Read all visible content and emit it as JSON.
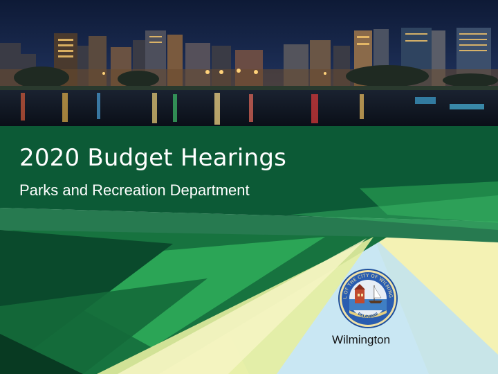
{
  "slide": {
    "title": "2020 Budget Hearings",
    "subtitle": "Parks and Recreation Department",
    "seal_label": "Wilmington",
    "seal_ring_text": "SEAL OF THE CITY OF WILMINGTON",
    "seal_bottom_text": "DELAWARE"
  },
  "colors": {
    "dark_green": "#0c5a36",
    "mid_green": "#1f8a4a",
    "bright_green": "#2fae5a",
    "light_green": "#8ccf7f",
    "pale_yellow": "#f4f2b4",
    "light_blue": "#bfe3f1",
    "night_sky": "#10203c"
  }
}
